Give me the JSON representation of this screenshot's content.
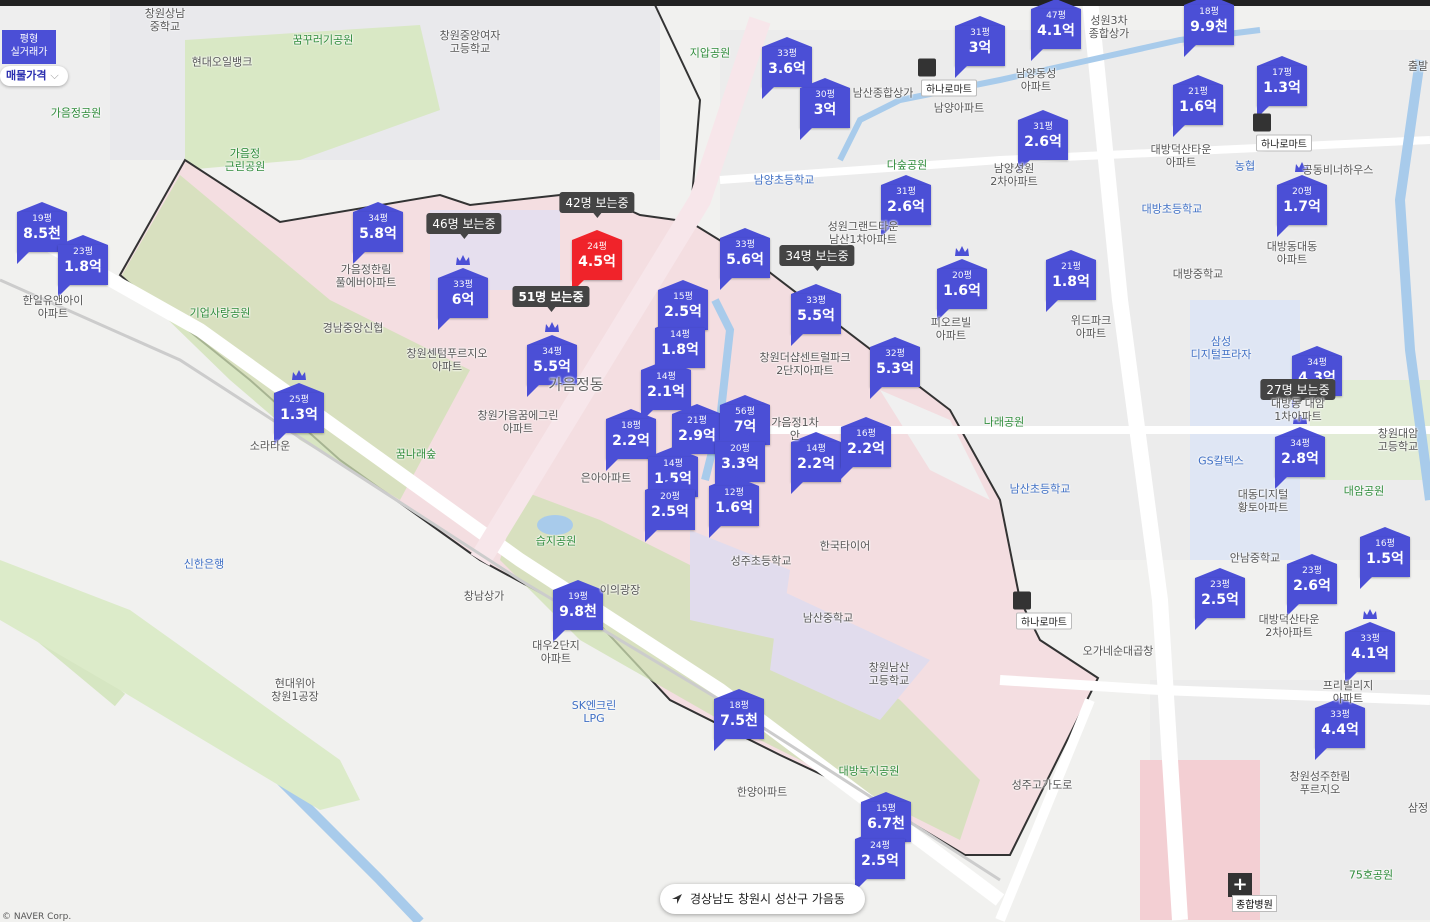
{
  "filter": {
    "tag_line1": "평형",
    "tag_line2": "실거래가",
    "dropdown_label": "매물가격"
  },
  "address": "경상남도 창원시 성산구 가음동",
  "copyright": "© NAVER Corp.",
  "colors": {
    "pin": "#4b4fd6",
    "pin_hot": "#f0232a",
    "region_fill": "#f5d9dd",
    "park": "#cfe3b6",
    "water": "#a8cbeb"
  },
  "district_label": "가음정동",
  "pins": [
    {
      "area": "19평",
      "price": "8.5천"
    },
    {
      "area": "23평",
      "price": "1.8억"
    },
    {
      "area": "34평",
      "price": "5.8억"
    },
    {
      "area": "33평",
      "price": "6억",
      "crown": true
    },
    {
      "area": "24평",
      "price": "4.5억",
      "hot": true
    },
    {
      "area": "34평",
      "price": "5.5억",
      "crown": true
    },
    {
      "area": "25평",
      "price": "1.3억",
      "crown": true
    },
    {
      "area": "33평",
      "price": "5.6억"
    },
    {
      "area": "15평",
      "price": "2.5억"
    },
    {
      "area": "14평",
      "price": "1.8억"
    },
    {
      "area": "14평",
      "price": "2.1억"
    },
    {
      "area": "18평",
      "price": "2.2억"
    },
    {
      "area": "21평",
      "price": "2.9억"
    },
    {
      "area": "56평",
      "price": "7억"
    },
    {
      "area": "20평",
      "price": "3.3억"
    },
    {
      "area": "14평",
      "price": "1.5억"
    },
    {
      "area": "20평",
      "price": "2.5억"
    },
    {
      "area": "12평",
      "price": "1.6억"
    },
    {
      "area": "14평",
      "price": "2.2억"
    },
    {
      "area": "16평",
      "price": "2.2억"
    },
    {
      "area": "33평",
      "price": "5.5억"
    },
    {
      "area": "32평",
      "price": "5.3억"
    },
    {
      "area": "19평",
      "price": "9.8천"
    },
    {
      "area": "18평",
      "price": "7.5천"
    },
    {
      "area": "15평",
      "price": "6.7천"
    },
    {
      "area": "24평",
      "price": "2.5억"
    },
    {
      "area": "33평",
      "price": "3.6억"
    },
    {
      "area": "30평",
      "price": "3억"
    },
    {
      "area": "31평",
      "price": "3억"
    },
    {
      "area": "47평",
      "price": "4.1억"
    },
    {
      "area": "18평",
      "price": "9.9천"
    },
    {
      "area": "17평",
      "price": "1.3억"
    },
    {
      "area": "21평",
      "price": "1.6억"
    },
    {
      "area": "31평",
      "price": "2.6억"
    },
    {
      "area": "31평",
      "price": "2.6억"
    },
    {
      "area": "20평",
      "price": "1.7억",
      "crown": true
    },
    {
      "area": "20평",
      "price": "1.6억",
      "crown": true
    },
    {
      "area": "21평",
      "price": "1.8억"
    },
    {
      "area": "34평",
      "price": "4.3억"
    },
    {
      "area": "34평",
      "price": "2.8억",
      "crown": true
    },
    {
      "area": "23평",
      "price": "2.5억"
    },
    {
      "area": "23평",
      "price": "2.6억"
    },
    {
      "area": "16평",
      "price": "1.5억"
    },
    {
      "area": "33평",
      "price": "4.1억",
      "crown": true
    },
    {
      "area": "33평",
      "price": "4.4억"
    }
  ],
  "viewers": [
    {
      "text": "42명 보는중"
    },
    {
      "text": "46명 보는중"
    },
    {
      "text": "51명 보는중",
      "bold": true
    },
    {
      "text": "34명 보는중"
    },
    {
      "text": "27명 보는중"
    }
  ],
  "stores": [
    "하나로마트",
    "하나로마트",
    "하나로마트"
  ],
  "hospital": "종합병원",
  "labels": [
    {
      "text": "창원상남\n중학교",
      "c": ""
    },
    {
      "text": "꿈꾸러기공원",
      "c": "green"
    },
    {
      "text": "창원중앙여자\n고등학교",
      "c": ""
    },
    {
      "text": "지압공원",
      "c": "green"
    },
    {
      "text": "현대오일뱅크",
      "c": ""
    },
    {
      "text": "가음정공원",
      "c": "green"
    },
    {
      "text": "가음정\n근린공원",
      "c": "green"
    },
    {
      "text": "가음정한림\n풀에버아파트",
      "c": ""
    },
    {
      "text": "한일유앤아이\n아파트",
      "c": ""
    },
    {
      "text": "기업사랑공원",
      "c": "green"
    },
    {
      "text": "경남중앙신협",
      "c": ""
    },
    {
      "text": "창원센텀푸르지오\n아파트",
      "c": ""
    },
    {
      "text": "소라타운",
      "c": ""
    },
    {
      "text": "창원가음꿈에그린\n아파트",
      "c": ""
    },
    {
      "text": "꿈나래숲",
      "c": "green"
    },
    {
      "text": "은아아파트",
      "c": ""
    },
    {
      "text": "습지공원",
      "c": "green"
    },
    {
      "text": "신한은행",
      "c": "blue"
    },
    {
      "text": "창남상가",
      "c": ""
    },
    {
      "text": "대우2단지\n아파트",
      "c": ""
    },
    {
      "text": "현대위아\n창원1공장",
      "c": ""
    },
    {
      "text": "SK엔크린\nLPG",
      "c": "blue"
    },
    {
      "text": "한양아파트",
      "c": ""
    },
    {
      "text": "성주초등학교",
      "c": ""
    },
    {
      "text": "한국타이어",
      "c": ""
    },
    {
      "text": "남산중학교",
      "c": ""
    },
    {
      "text": "창원남산\n고등학교",
      "c": ""
    },
    {
      "text": "대방녹지공원",
      "c": "green"
    },
    {
      "text": "창원더샵센트럴파크\n2단지아파트",
      "c": ""
    },
    {
      "text": "가음정1차\n안",
      "c": ""
    },
    {
      "text": "남양초등학교",
      "c": "blue"
    },
    {
      "text": "남산종합상가",
      "c": ""
    },
    {
      "text": "다숲공원",
      "c": "green"
    },
    {
      "text": "성원그랜드타운\n남산1차아파트",
      "c": ""
    },
    {
      "text": "남양아파트",
      "c": ""
    },
    {
      "text": "남양동성\n아파트",
      "c": ""
    },
    {
      "text": "남양성원\n2차아파트",
      "c": ""
    },
    {
      "text": "성원3차\n종합상가",
      "c": ""
    },
    {
      "text": "대방덕산타운\n아파트",
      "c": ""
    },
    {
      "text": "대방초등학교",
      "c": "blue"
    },
    {
      "text": "대방중학교",
      "c": ""
    },
    {
      "text": "대방동대동\n아파트",
      "c": ""
    },
    {
      "text": "피오르빌\n아파트",
      "c": ""
    },
    {
      "text": "위드파크\n아파트",
      "c": ""
    },
    {
      "text": "삼성\n디지털프라자",
      "c": "blue"
    },
    {
      "text": "나래공원",
      "c": "green"
    },
    {
      "text": "GS칼텍스",
      "c": "blue"
    },
    {
      "text": "남산초등학교",
      "c": "blue"
    },
    {
      "text": "대동디지털\n황토아파트",
      "c": ""
    },
    {
      "text": "창원대암\n고등학교",
      "c": ""
    },
    {
      "text": "대암공원",
      "c": "green"
    },
    {
      "text": "안남중학교",
      "c": ""
    },
    {
      "text": "대방덕산타운\n2차아파트",
      "c": ""
    },
    {
      "text": "프리빌리지\n아파트",
      "c": ""
    },
    {
      "text": "창원성주한림\n푸르지오",
      "c": ""
    },
    {
      "text": "오가네순대곱창",
      "c": ""
    },
    {
      "text": "성주고가도로",
      "c": ""
    },
    {
      "text": "75호공원",
      "c": "green"
    },
    {
      "text": "농협",
      "c": "blue"
    },
    {
      "text": "출발",
      "c": ""
    },
    {
      "text": "삼정",
      "c": ""
    },
    {
      "text": "이의광장",
      "c": ""
    },
    {
      "text": "대방동 대암\n1차아파트",
      "c": ""
    },
    {
      "text": "공동비너하우스",
      "c": ""
    }
  ]
}
